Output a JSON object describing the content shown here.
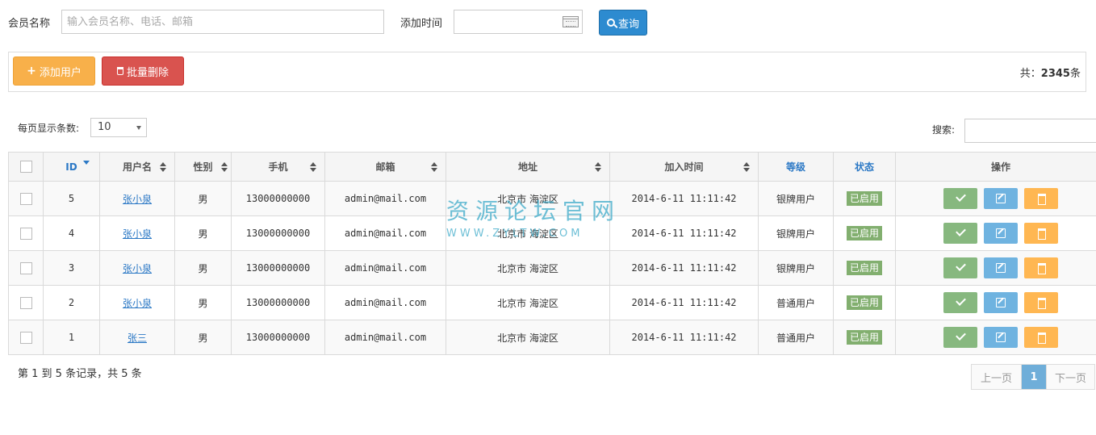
{
  "filter": {
    "member_label": "会员名称",
    "member_placeholder": "输入会员名称、电话、邮箱",
    "date_label": "添加时间",
    "date_value": "",
    "query_label": "查询"
  },
  "toolbar": {
    "add_label": "添加用户",
    "batch_delete_label": "批量删除",
    "total_prefix": "共：",
    "total_count": "2345",
    "total_suffix": "条"
  },
  "list_controls": {
    "page_length_label": "每页显示条数:",
    "page_length_value": "10",
    "search_label": "搜索:"
  },
  "table": {
    "headers": [
      "",
      "ID",
      "用户名",
      "性别",
      "手机",
      "邮箱",
      "地址",
      "加入时间",
      "等级",
      "状态",
      "操作"
    ],
    "rows": [
      {
        "id": "5",
        "name": "张小泉",
        "gender": "男",
        "phone": "13000000000",
        "email": "admin@mail.com",
        "address": "北京市 海淀区",
        "joined": "2014-6-11 11:11:42",
        "level": "银牌用户",
        "status": "已启用"
      },
      {
        "id": "4",
        "name": "张小泉",
        "gender": "男",
        "phone": "13000000000",
        "email": "admin@mail.com",
        "address": "北京市 海淀区",
        "joined": "2014-6-11 11:11:42",
        "level": "银牌用户",
        "status": "已启用"
      },
      {
        "id": "3",
        "name": "张小泉",
        "gender": "男",
        "phone": "13000000000",
        "email": "admin@mail.com",
        "address": "北京市 海淀区",
        "joined": "2014-6-11 11:11:42",
        "level": "银牌用户",
        "status": "已启用"
      },
      {
        "id": "2",
        "name": "张小泉",
        "gender": "男",
        "phone": "13000000000",
        "email": "admin@mail.com",
        "address": "北京市 海淀区",
        "joined": "2014-6-11 11:11:42",
        "level": "普通用户",
        "status": "已启用"
      },
      {
        "id": "1",
        "name": "张三",
        "gender": "男",
        "phone": "13000000000",
        "email": "admin@mail.com",
        "address": "北京市 海淀区",
        "joined": "2014-6-11 11:11:42",
        "level": "普通用户",
        "status": "已启用"
      }
    ]
  },
  "footer": {
    "info": "第 1 到 5 条记录，共 5 条",
    "prev": "上一页",
    "current_page": "1",
    "next": "下一页"
  },
  "watermark": {
    "main": "资源论坛官网",
    "sub": "WWW.ZYLTW.COM"
  },
  "icons": {
    "query": "search-icon",
    "add": "plus-icon",
    "batch_delete": "trash-icon",
    "calendar": "calendar-icon",
    "row_enable": "check-icon",
    "row_edit": "edit-icon",
    "row_delete": "trash-icon"
  },
  "colors": {
    "primary": "#2d8bd0",
    "warning": "#f8b04a",
    "danger": "#d9534f",
    "success": "#87b87f",
    "info": "#6fb3e0",
    "badge": "#82af6f"
  }
}
